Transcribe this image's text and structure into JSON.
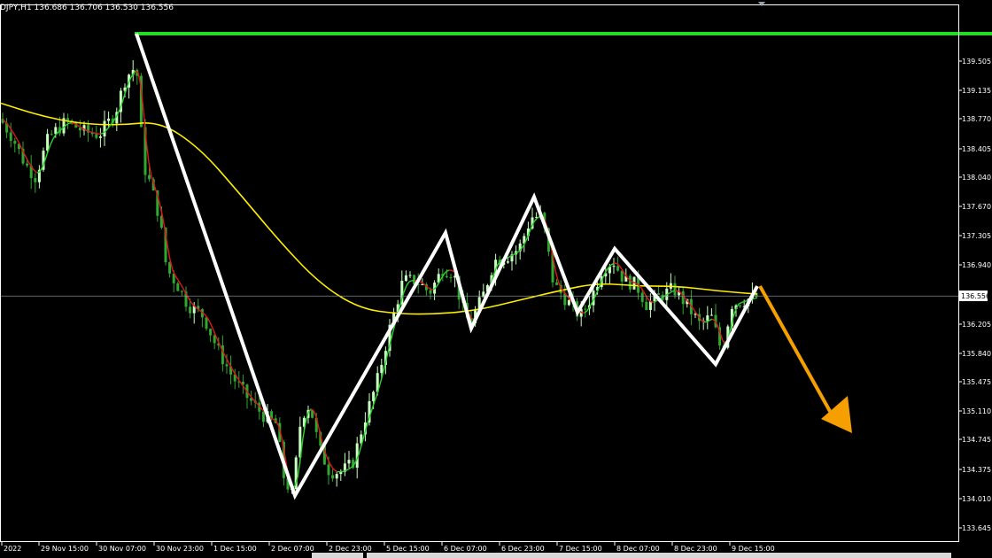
{
  "header": {
    "symbol_info": "DJPY,H1  136.686 136.706 136.530 136.556"
  },
  "price_axis": {
    "labels": [
      "139.505",
      "139.135",
      "138.770",
      "138.405",
      "138.040",
      "137.670",
      "137.305",
      "136.940",
      "136.556",
      "136.205",
      "135.840",
      "135.475",
      "135.110",
      "134.745",
      "134.375",
      "134.010",
      "133.645"
    ],
    "current_price": "136.556",
    "current_price_value": 136.556
  },
  "time_axis": {
    "labels": [
      "2022",
      "29 Nov 15:00",
      "30 Nov 07:00",
      "30 Nov 23:00",
      "1 Dec 15:00",
      "2 Dec 07:00",
      "2 Dec 23:00",
      "5 Dec 15:00",
      "6 Dec 07:00",
      "6 Dec 23:00",
      "7 Dec 15:00",
      "8 Dec 07:00",
      "8 Dec 23:00",
      "9 Dec 15:00"
    ]
  },
  "colors": {
    "background": "#000000",
    "axis_line": "#ffffff",
    "axis_text": "#ffffff",
    "grid_current_price": "#9aa3ad",
    "candle_bull": "#c8ffc0",
    "candle_bear": "#2ea82e",
    "ma_slow": "#ffee00",
    "ma_fast_up": "#2bd42b",
    "ma_fast_down": "#e01818",
    "resistance_line": "#22dd22",
    "zigzag": "#ffffff",
    "forecast_arrow": "#f5a000",
    "price_tag_bg": "#ffffff",
    "price_tag_text": "#000000"
  },
  "chart_data": {
    "type": "line",
    "resistance_level": 139.85,
    "zigzag_pivots": [
      {
        "label": "30 Nov 07:00",
        "price": 139.85
      },
      {
        "label": "2 Dec 07:00",
        "price": 134.05
      },
      {
        "label": "6 Dec 07:00",
        "price": 137.35
      },
      {
        "label": "6 Dec 07:00",
        "price": 136.15
      },
      {
        "label": "7 Dec 15:00",
        "price": 137.8
      },
      {
        "label": "7 Dec 15:00",
        "price": 136.35
      },
      {
        "label": "8 Dec 07:00",
        "price": 137.15
      },
      {
        "label": "9 Dec 07:00",
        "price": 135.7
      },
      {
        "label": "9 Dec 15:00",
        "price": 136.68
      }
    ],
    "ma_slow": [
      138.98,
      138.82,
      138.72,
      138.7,
      138.75,
      138.42,
      137.85,
      137.25,
      136.72,
      136.4,
      136.33,
      136.33,
      136.38,
      136.5,
      136.62,
      136.72,
      136.68,
      136.68,
      136.62,
      136.58
    ],
    "forecast": {
      "from_price": 136.68,
      "to_price": 135.05,
      "direction": "down"
    }
  }
}
